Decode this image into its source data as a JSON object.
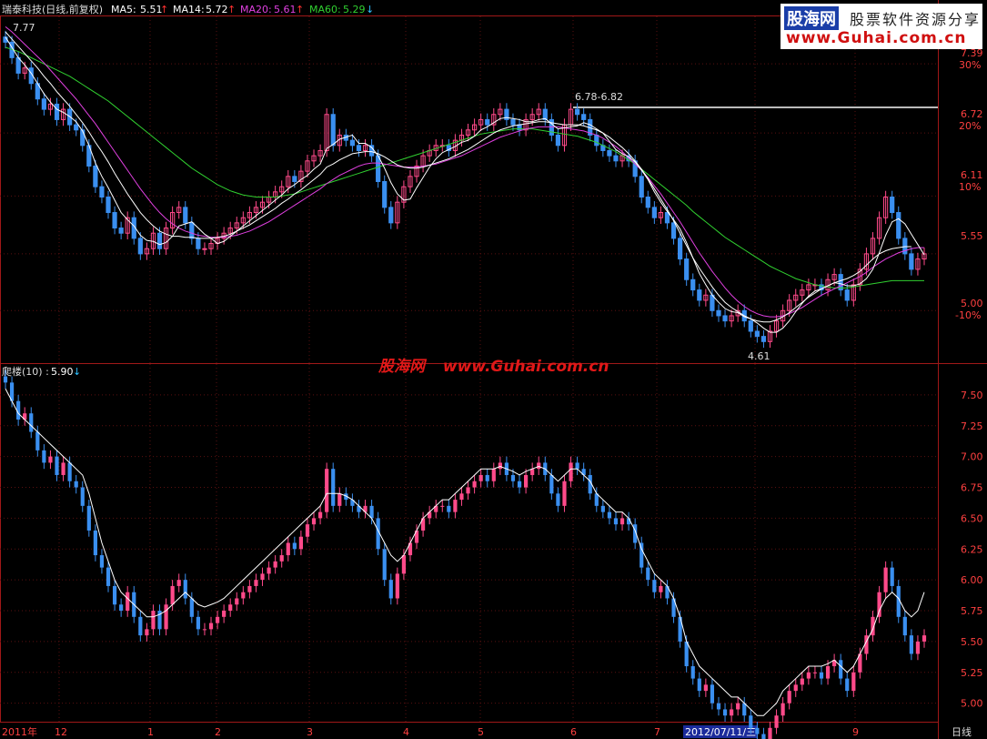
{
  "upper_panel": {
    "stock_name": "瑞泰科技(日线,前复权)",
    "ma": [
      {
        "label": "MA5:",
        "value": "5.51",
        "arrow": "↑",
        "color": "#ffffff"
      },
      {
        "label": "MA14:",
        "value": "5.72",
        "arrow": "↑",
        "color": "#ffffff"
      },
      {
        "label": "MA20:",
        "value": "5.61",
        "arrow": "↑",
        "color": "#e040e0"
      },
      {
        "label": "MA60:",
        "value": "5.29",
        "arrow": "↓",
        "color": "#30d030"
      }
    ],
    "max_label": "7.77",
    "range_label": "6.78-6.82",
    "min_label": "4.61",
    "right_axis": [
      {
        "price": "7.39",
        "pct": "30%"
      },
      {
        "price": "6.72",
        "pct": "20%"
      },
      {
        "price": "6.11",
        "pct": "10%"
      },
      {
        "price": "5.55",
        "pct": ""
      },
      {
        "price": "5.00",
        "pct": "-10%"
      }
    ]
  },
  "lower_panel": {
    "indicator": "爬楼(10) :",
    "value": "5.90",
    "arrow": "↓",
    "right_axis": [
      "7.50",
      "7.25",
      "7.00",
      "6.75",
      "6.50",
      "6.25",
      "6.00",
      "5.75",
      "5.50",
      "5.25",
      "5.00"
    ]
  },
  "date_axis": [
    "2011年",
    "12",
    "1",
    "2",
    "3",
    "4",
    "5",
    "6",
    "7",
    "2012/07/11/三",
    "9"
  ],
  "period_label": "日线",
  "logo": {
    "brand": "股海网",
    "tagline": "股票软件资源分享",
    "url": "www.Guhai.com.cn"
  },
  "watermark": {
    "brand": "股海网",
    "url": "www.Guhai.com.cn"
  },
  "colors": {
    "up": "#ff4a8a",
    "down": "#3a8ff0",
    "ma5": "#ffffff",
    "ma14": "#ffffff",
    "ma20": "#e040e0",
    "ma60": "#30d030",
    "axis": "#a01818",
    "grid": "#5a1010"
  },
  "chart_data": {
    "type": "candlestick",
    "upper_y_range": [
      4.5,
      7.85
    ],
    "lower_y_range": [
      4.85,
      7.75
    ],
    "close": [
      7.6,
      7.45,
      7.3,
      7.35,
      7.2,
      7.05,
      6.95,
      7.0,
      6.85,
      6.95,
      6.8,
      6.75,
      6.6,
      6.4,
      6.2,
      6.1,
      5.95,
      5.8,
      5.75,
      5.9,
      5.7,
      5.55,
      5.6,
      5.75,
      5.6,
      5.8,
      5.95,
      6.0,
      5.85,
      5.7,
      5.6,
      5.6,
      5.65,
      5.7,
      5.75,
      5.8,
      5.85,
      5.9,
      5.95,
      6.0,
      6.05,
      6.1,
      6.15,
      6.2,
      6.3,
      6.25,
      6.35,
      6.45,
      6.5,
      6.55,
      6.9,
      6.6,
      6.7,
      6.65,
      6.6,
      6.55,
      6.6,
      6.5,
      6.25,
      6.0,
      5.85,
      6.05,
      6.2,
      6.3,
      6.4,
      6.5,
      6.55,
      6.6,
      6.6,
      6.55,
      6.65,
      6.7,
      6.75,
      6.8,
      6.85,
      6.8,
      6.9,
      6.95,
      6.85,
      6.8,
      6.75,
      6.85,
      6.9,
      6.95,
      6.85,
      6.7,
      6.6,
      6.8,
      6.95,
      6.9,
      6.85,
      6.7,
      6.6,
      6.55,
      6.5,
      6.45,
      6.5,
      6.45,
      6.3,
      6.1,
      6.0,
      5.9,
      5.95,
      5.85,
      5.7,
      5.5,
      5.3,
      5.2,
      5.1,
      5.15,
      5.0,
      4.95,
      4.9,
      4.95,
      5.0,
      4.9,
      4.8,
      4.75,
      4.7,
      4.8,
      4.9,
      5.0,
      5.1,
      5.15,
      5.2,
      5.25,
      5.25,
      5.2,
      5.3,
      5.35,
      5.2,
      5.1,
      5.25,
      5.4,
      5.55,
      5.7,
      5.9,
      6.1,
      5.95,
      5.7,
      5.55,
      5.4,
      5.5,
      5.55
    ],
    "ma5": [
      7.65,
      7.55,
      7.45,
      7.38,
      7.3,
      7.2,
      7.1,
      7.02,
      6.95,
      6.92,
      6.88,
      6.83,
      6.74,
      6.6,
      6.43,
      6.3,
      6.19,
      6.07,
      5.95,
      5.88,
      5.82,
      5.73,
      5.68,
      5.67,
      5.64,
      5.66,
      5.72,
      5.82,
      5.84,
      5.86,
      5.8,
      5.74,
      5.7,
      5.65,
      5.67,
      5.72,
      5.77,
      5.82,
      5.87,
      5.92,
      5.97,
      6.02,
      6.07,
      6.12,
      6.18,
      6.22,
      6.27,
      6.31,
      6.37,
      6.42,
      6.57,
      6.61,
      6.66,
      6.68,
      6.7,
      6.62,
      6.62,
      6.58,
      6.5,
      6.38,
      6.24,
      6.13,
      6.07,
      6.08,
      6.19,
      6.29,
      6.39,
      6.47,
      6.53,
      6.56,
      6.59,
      6.63,
      6.65,
      6.69,
      6.75,
      6.78,
      6.82,
      6.86,
      6.87,
      6.86,
      6.85,
      6.83,
      6.83,
      6.85,
      6.86,
      6.81,
      6.76,
      6.77,
      6.78,
      6.79,
      6.82,
      6.8,
      6.76,
      6.72,
      6.64,
      6.56,
      6.52,
      6.49,
      6.44,
      6.36,
      6.27,
      6.15,
      6.05,
      5.96,
      5.88,
      5.79,
      5.66,
      5.51,
      5.36,
      5.25,
      5.15,
      5.08,
      5.02,
      4.99,
      4.98,
      4.94,
      4.92,
      4.88,
      4.83,
      4.79,
      4.79,
      4.83,
      4.9,
      4.99,
      5.07,
      5.14,
      5.19,
      5.21,
      5.24,
      5.27,
      5.26,
      5.24,
      5.24,
      5.26,
      5.31,
      5.4,
      5.56,
      5.73,
      5.86,
      5.89,
      5.84,
      5.74,
      5.64,
      5.54
    ],
    "ma14": [
      7.7,
      7.63,
      7.56,
      7.49,
      7.42,
      7.35,
      7.27,
      7.2,
      7.12,
      7.05,
      6.98,
      6.9,
      6.82,
      6.73,
      6.63,
      6.54,
      6.44,
      6.33,
      6.23,
      6.13,
      6.04,
      5.95,
      5.88,
      5.82,
      5.77,
      5.74,
      5.72,
      5.72,
      5.71,
      5.71,
      5.7,
      5.7,
      5.7,
      5.71,
      5.72,
      5.74,
      5.77,
      5.8,
      5.83,
      5.87,
      5.91,
      5.95,
      5.99,
      6.04,
      6.08,
      6.13,
      6.17,
      6.22,
      6.27,
      6.32,
      6.39,
      6.42,
      6.46,
      6.49,
      6.52,
      6.53,
      6.54,
      6.54,
      6.52,
      6.49,
      6.45,
      6.41,
      6.39,
      6.38,
      6.38,
      6.39,
      6.41,
      6.43,
      6.45,
      6.47,
      6.5,
      6.53,
      6.56,
      6.6,
      6.64,
      6.68,
      6.72,
      6.75,
      6.77,
      6.79,
      6.8,
      6.81,
      6.82,
      6.83,
      6.83,
      6.82,
      6.81,
      6.8,
      6.8,
      6.8,
      6.79,
      6.77,
      6.75,
      6.72,
      6.68,
      6.63,
      6.58,
      6.52,
      6.45,
      6.37,
      6.28,
      6.18,
      6.08,
      5.98,
      5.87,
      5.75,
      5.63,
      5.51,
      5.41,
      5.32,
      5.23,
      5.15,
      5.08,
      5.03,
      4.99,
      4.95,
      4.92,
      4.9,
      4.89,
      4.89,
      4.91,
      4.94,
      4.98,
      5.03,
      5.08,
      5.13,
      5.17,
      5.21,
      5.24,
      5.27,
      5.29,
      5.31,
      5.34,
      5.38,
      5.44,
      5.5,
      5.55,
      5.58,
      5.6,
      5.61,
      5.62,
      5.62
    ],
    "ma20": [
      7.75,
      7.7,
      7.64,
      7.58,
      7.52,
      7.46,
      7.4,
      7.33,
      7.26,
      7.19,
      7.12,
      7.05,
      6.97,
      6.89,
      6.81,
      6.72,
      6.63,
      6.54,
      6.45,
      6.36,
      6.27,
      6.18,
      6.1,
      6.02,
      5.95,
      5.89,
      5.84,
      5.8,
      5.77,
      5.75,
      5.73,
      5.72,
      5.71,
      5.71,
      5.71,
      5.72,
      5.73,
      5.75,
      5.77,
      5.8,
      5.83,
      5.86,
      5.9,
      5.94,
      5.98,
      6.02,
      6.06,
      6.1,
      6.14,
      6.18,
      6.23,
      6.27,
      6.31,
      6.34,
      6.37,
      6.4,
      6.42,
      6.43,
      6.43,
      6.42,
      6.41,
      6.4,
      6.39,
      6.39,
      6.39,
      6.4,
      6.41,
      6.42,
      6.44,
      6.46,
      6.48,
      6.5,
      6.53,
      6.56,
      6.59,
      6.62,
      6.65,
      6.68,
      6.7,
      6.72,
      6.74,
      6.76,
      6.77,
      6.78,
      6.78,
      6.78,
      6.78,
      6.77,
      6.76,
      6.75,
      6.74,
      6.72,
      6.7,
      6.67,
      6.63,
      6.59,
      6.54,
      6.48,
      6.42,
      6.36,
      6.29,
      6.21,
      6.13,
      6.04,
      5.95,
      5.86,
      5.76,
      5.66,
      5.56,
      5.47,
      5.38,
      5.3,
      5.22,
      5.15,
      5.09,
      5.04,
      5.0,
      4.97,
      4.95,
      4.94,
      4.94,
      4.95,
      4.97,
      5.0,
      5.03,
      5.07,
      5.11,
      5.15,
      5.18,
      5.21,
      5.24,
      5.27,
      5.3,
      5.33,
      5.37,
      5.42,
      5.46,
      5.5,
      5.53,
      5.56,
      5.58,
      5.6,
      5.61,
      5.61
    ],
    "ma60": [
      7.55,
      7.53,
      7.51,
      7.48,
      7.45,
      7.42,
      7.39,
      7.36,
      7.33,
      7.3,
      7.27,
      7.23,
      7.19,
      7.15,
      7.11,
      7.07,
      7.03,
      6.98,
      6.93,
      6.88,
      6.83,
      6.78,
      6.73,
      6.68,
      6.63,
      6.58,
      6.53,
      6.48,
      6.43,
      6.38,
      6.34,
      6.3,
      6.26,
      6.22,
      6.19,
      6.16,
      6.14,
      6.12,
      6.11,
      6.1,
      6.1,
      6.1,
      6.1,
      6.11,
      6.12,
      6.13,
      6.15,
      6.17,
      6.19,
      6.21,
      6.23,
      6.25,
      6.27,
      6.29,
      6.31,
      6.33,
      6.35,
      6.37,
      6.39,
      6.41,
      6.43,
      6.45,
      6.47,
      6.49,
      6.51,
      6.53,
      6.55,
      6.57,
      6.59,
      6.61,
      6.63,
      6.65,
      6.67,
      6.69,
      6.71,
      6.72,
      6.73,
      6.74,
      6.75,
      6.76,
      6.76,
      6.76,
      6.76,
      6.75,
      6.74,
      6.73,
      6.72,
      6.71,
      6.7,
      6.69,
      6.67,
      6.65,
      6.63,
      6.6,
      6.57,
      6.54,
      6.5,
      6.46,
      6.42,
      6.37,
      6.32,
      6.27,
      6.22,
      6.17,
      6.12,
      6.07,
      6.02,
      5.96,
      5.91,
      5.86,
      5.81,
      5.76,
      5.71,
      5.67,
      5.63,
      5.59,
      5.55,
      5.51,
      5.47,
      5.43,
      5.4,
      5.37,
      5.34,
      5.31,
      5.29,
      5.27,
      5.25,
      5.24,
      5.23,
      5.22,
      5.22,
      5.22,
      5.23,
      5.24,
      5.25,
      5.26,
      5.27,
      5.28,
      5.29,
      5.29,
      5.29,
      5.29,
      5.29,
      5.29
    ],
    "climb10": [
      7.55,
      7.45,
      7.35,
      7.3,
      7.25,
      7.2,
      7.15,
      7.1,
      7.05,
      7.0,
      6.95,
      6.9,
      6.85,
      6.7,
      6.5,
      6.3,
      6.15,
      6.0,
      5.9,
      5.85,
      5.8,
      5.75,
      5.7,
      5.7,
      5.72,
      5.75,
      5.8,
      5.85,
      5.9,
      5.85,
      5.8,
      5.78,
      5.8,
      5.82,
      5.85,
      5.9,
      5.95,
      6.0,
      6.05,
      6.1,
      6.15,
      6.2,
      6.25,
      6.3,
      6.35,
      6.4,
      6.45,
      6.5,
      6.55,
      6.6,
      6.7,
      6.7,
      6.7,
      6.68,
      6.65,
      6.6,
      6.55,
      6.5,
      6.4,
      6.3,
      6.2,
      6.15,
      6.2,
      6.3,
      6.4,
      6.5,
      6.55,
      6.6,
      6.65,
      6.65,
      6.7,
      6.75,
      6.8,
      6.85,
      6.9,
      6.9,
      6.9,
      6.92,
      6.9,
      6.88,
      6.85,
      6.88,
      6.9,
      6.92,
      6.9,
      6.85,
      6.8,
      6.85,
      6.9,
      6.9,
      6.85,
      6.8,
      6.7,
      6.65,
      6.6,
      6.55,
      6.55,
      6.5,
      6.4,
      6.25,
      6.15,
      6.05,
      6.0,
      5.95,
      5.85,
      5.7,
      5.5,
      5.4,
      5.3,
      5.25,
      5.2,
      5.15,
      5.1,
      5.05,
      5.05,
      5.0,
      4.95,
      4.9,
      4.9,
      4.95,
      5.0,
      5.1,
      5.15,
      5.2,
      5.25,
      5.3,
      5.3,
      5.3,
      5.32,
      5.35,
      5.3,
      5.25,
      5.3,
      5.4,
      5.5,
      5.6,
      5.75,
      5.85,
      5.9,
      5.85,
      5.75,
      5.7,
      5.75,
      5.9
    ]
  }
}
